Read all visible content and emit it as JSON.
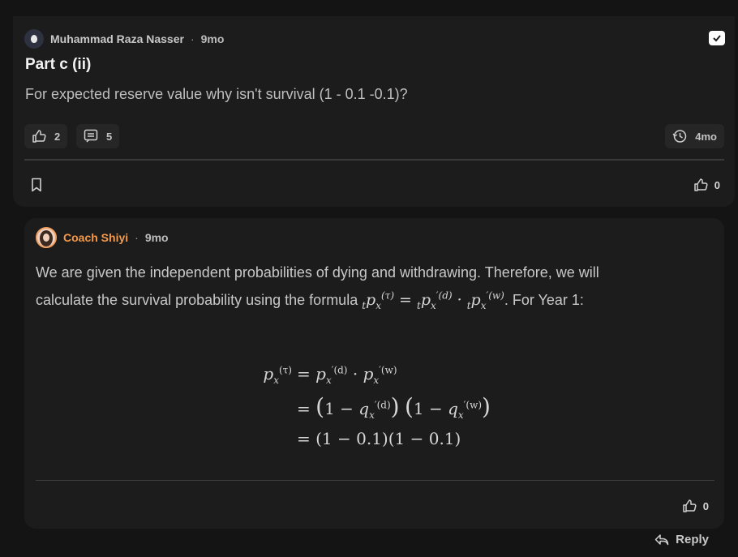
{
  "post": {
    "author": "Muhammad Raza Nasser",
    "separator": "·",
    "age": "9mo",
    "title": "Part c (ii)",
    "body": "For expected reserve value why isn't survival (1 - 0.1 -0.1)?",
    "likes": "2",
    "comments": "5",
    "history_label": "4mo",
    "action_likes": "0"
  },
  "comment": {
    "author": "Coach Shiyi",
    "separator": "·",
    "age": "9mo",
    "text_line1": "We are given the independent probabilities of dying and withdrawing. Therefore, we will",
    "text_prefix": "calculate the survival probability using the formula ",
    "text_suffix": ". For Year 1:",
    "likes": "0",
    "colors": {
      "coach": "#f59a4a"
    }
  },
  "reply_label": "Reply",
  "icons": [
    "avatar-icon",
    "verified-check-icon",
    "thumbs-up-icon",
    "comment-icon",
    "history-icon",
    "bookmark-icon",
    "reply-icon"
  ]
}
